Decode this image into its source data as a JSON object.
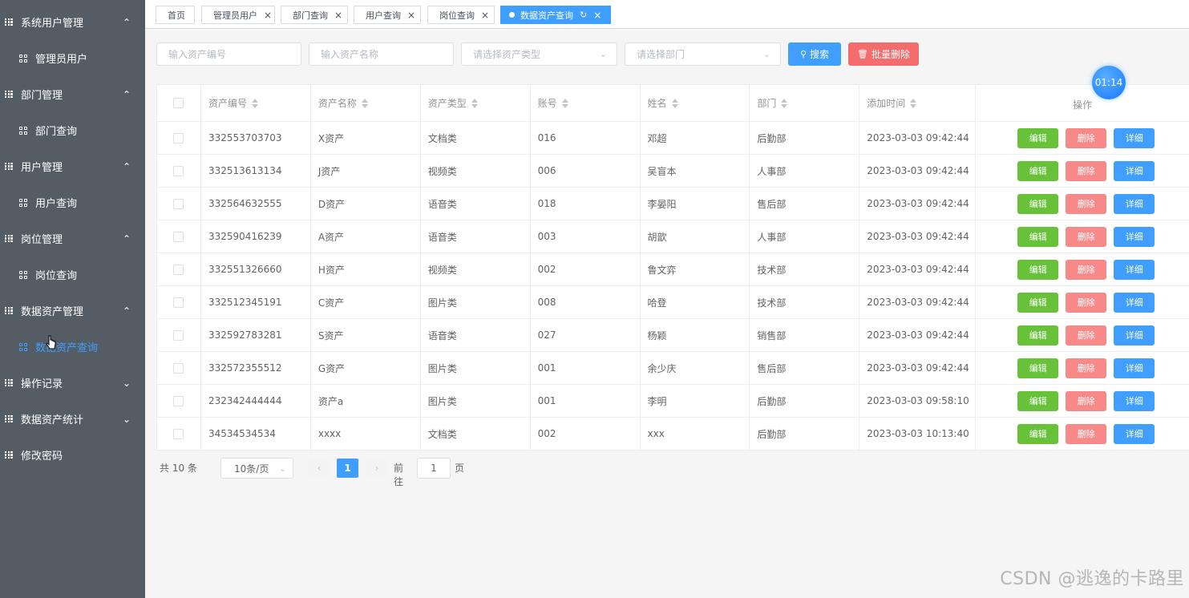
{
  "sidebar": {
    "groups": [
      {
        "label": "系统用户管理",
        "expanded": true,
        "items": [
          "管理员用户"
        ]
      },
      {
        "label": "部门管理",
        "expanded": true,
        "items": [
          "部门查询"
        ]
      },
      {
        "label": "用户管理",
        "expanded": true,
        "items": [
          "用户查询"
        ]
      },
      {
        "label": "岗位管理",
        "expanded": true,
        "items": [
          "岗位查询"
        ]
      },
      {
        "label": "数据资产管理",
        "expanded": true,
        "items": [
          "数据资产查询"
        ],
        "active_item": "数据资产查询"
      },
      {
        "label": "操作记录",
        "expanded": false,
        "items": []
      },
      {
        "label": "数据资产统计",
        "expanded": false,
        "items": []
      },
      {
        "label": "修改密码",
        "expanded": false,
        "items": []
      }
    ]
  },
  "tabs": [
    {
      "label": "首页",
      "closable": false,
      "active": false
    },
    {
      "label": "管理员用户",
      "closable": true,
      "active": false
    },
    {
      "label": "部门查询",
      "closable": true,
      "active": false
    },
    {
      "label": "用户查询",
      "closable": true,
      "active": false
    },
    {
      "label": "岗位查询",
      "closable": true,
      "active": false
    },
    {
      "label": "数据资产查询",
      "closable": true,
      "active": true
    }
  ],
  "filters": {
    "asset_no_placeholder": "输入资产编号",
    "asset_name_placeholder": "输入资产名称",
    "asset_type_placeholder": "请选择资产类型",
    "dept_placeholder": "请选择部门",
    "search_label": "搜索",
    "batch_delete_label": "批量删除"
  },
  "timer": "01:14",
  "table": {
    "columns": [
      "资产编号",
      "资产名称",
      "资产类型",
      "账号",
      "姓名",
      "部门",
      "添加时间",
      "操作"
    ],
    "action_labels": {
      "edit": "编辑",
      "delete": "删除",
      "detail": "详细"
    },
    "rows": [
      [
        "332553703703",
        "X资产",
        "文档类",
        "016",
        "邓超",
        "后勤部",
        "2023-03-03 09:42:44"
      ],
      [
        "332513613134",
        "J资产",
        "视频类",
        "006",
        "吴盲本",
        "人事部",
        "2023-03-03 09:42:44"
      ],
      [
        "332564632555",
        "D资产",
        "语音类",
        "018",
        "李晏阳",
        "售后部",
        "2023-03-03 09:42:44"
      ],
      [
        "332590416239",
        "A资产",
        "语音类",
        "003",
        "胡歆",
        "人事部",
        "2023-03-03 09:42:44"
      ],
      [
        "332551326660",
        "H资产",
        "视频类",
        "002",
        "鲁文弈",
        "技术部",
        "2023-03-03 09:42:44"
      ],
      [
        "332512345191",
        "C资产",
        "图片类",
        "008",
        "哈登",
        "技术部",
        "2023-03-03 09:42:44"
      ],
      [
        "332592783281",
        "S资产",
        "语音类",
        "027",
        "杨颖",
        "销售部",
        "2023-03-03 09:42:44"
      ],
      [
        "332572355512",
        "G资产",
        "图片类",
        "001",
        "余少庆",
        "售后部",
        "2023-03-03 09:42:44"
      ],
      [
        "232342444444",
        "资产a",
        "图片类",
        "001",
        "李明",
        "后勤部",
        "2023-03-03 09:58:10"
      ],
      [
        "34534534534",
        "xxxx",
        "文档类",
        "002",
        "xxx",
        "后勤部",
        "2023-03-03 10:13:40"
      ]
    ]
  },
  "pagination": {
    "total_text": "共 10 条",
    "page_size": "10条/页",
    "current_page": "1",
    "goto_label": "前往",
    "goto_value": "1",
    "page_suffix": "页"
  },
  "watermark": "CSDN @逃逸的卡路里"
}
